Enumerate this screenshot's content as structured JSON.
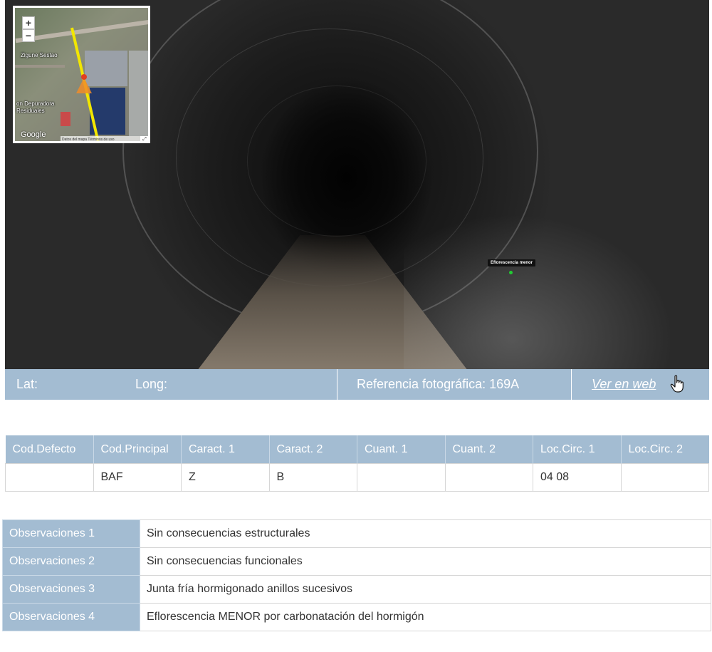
{
  "photo": {
    "defect_tag": "Eflorescencia menor"
  },
  "minimap": {
    "zoom_in": "+",
    "zoom_out": "−",
    "label_top": "Zigune Sestao",
    "label_mid1": "on Depuradora",
    "label_mid2": "Residuales",
    "brand": "Google",
    "footer": "Datos del mapa   Términos de uso",
    "fullscreen": "⤢"
  },
  "info_bar": {
    "lat_label": "Lat:",
    "long_label": "Long:",
    "photo_ref": "Referencia fotográfica: 169A",
    "web_link": "Ver en web"
  },
  "defect_table": {
    "headers": [
      "Cod.Defecto",
      "Cod.Principal",
      "Caract. 1",
      "Caract. 2",
      "Cuant. 1",
      "Cuant. 2",
      "Loc.Circ. 1",
      "Loc.Circ. 2"
    ],
    "row": [
      "",
      "BAF",
      "Z",
      "B",
      "",
      "",
      "04 08",
      ""
    ]
  },
  "observations": [
    {
      "label": "Observaciones 1",
      "value": "Sin consecuencias estructurales"
    },
    {
      "label": "Observaciones 2",
      "value": "Sin consecuencias funcionales"
    },
    {
      "label": "Observaciones 3",
      "value": "Junta fría hormigonado anillos sucesivos"
    },
    {
      "label": "Observaciones 4",
      "value": "Eflorescencia MENOR por carbonatación del hormigón"
    }
  ],
  "colors": {
    "header_blue": "#a3bcd2",
    "defect_marker": "#22cc33",
    "pipeline_line": "#f2e600"
  },
  "icons": [
    "plus-icon",
    "minus-icon",
    "fullscreen-icon",
    "hand-cursor-icon",
    "location-pin-icon"
  ]
}
